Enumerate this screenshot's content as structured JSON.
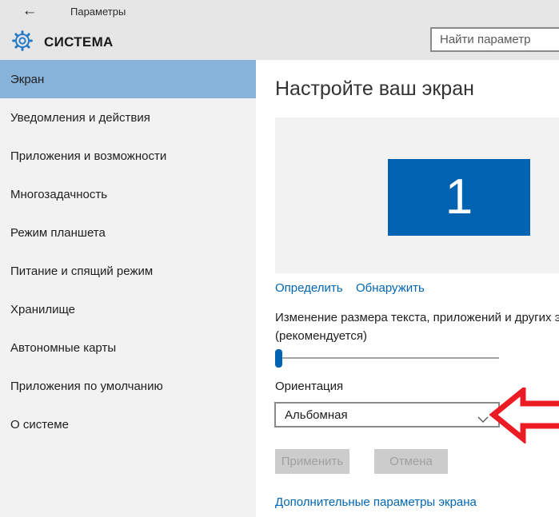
{
  "window": {
    "back_glyph": "←",
    "title": "Параметры"
  },
  "header": {
    "section_title": "СИСТЕМА",
    "search_placeholder": "Найти параметр"
  },
  "sidebar": {
    "items": [
      {
        "label": "Экран",
        "selected": true
      },
      {
        "label": "Уведомления и действия",
        "selected": false
      },
      {
        "label": "Приложения и возможности",
        "selected": false
      },
      {
        "label": "Многозадачность",
        "selected": false
      },
      {
        "label": "Режим планшета",
        "selected": false
      },
      {
        "label": "Питание и спящий режим",
        "selected": false
      },
      {
        "label": "Хранилище",
        "selected": false
      },
      {
        "label": "Автономные карты",
        "selected": false
      },
      {
        "label": "Приложения по умолчанию",
        "selected": false
      },
      {
        "label": "О системе",
        "selected": false
      }
    ]
  },
  "main": {
    "heading": "Настройте ваш экран",
    "monitor_number": "1",
    "identify_link": "Определить",
    "detect_link": "Обнаружить",
    "scale_text_line1": "Изменение размера текста, приложений и других эл",
    "scale_text_line2": "(рекомендуется)",
    "slider_position_percent": 0,
    "orientation_label": "Ориентация",
    "orientation_value": "Альбомная",
    "apply_button": "Применить",
    "cancel_button": "Отмена",
    "advanced_link": "Дополнительные параметры экрана"
  },
  "colors": {
    "header_bg": "#e6e6e6",
    "sidebar_bg": "#f2f2f2",
    "sidebar_selected_bg": "#87b2d9",
    "accent_link_blue": "#0066b4",
    "monitor_blue": "#0063b1",
    "gear_icon_blue": "#2779c8",
    "annotation_red": "#ec1c24",
    "disabled_button_bg": "#cccccc"
  }
}
